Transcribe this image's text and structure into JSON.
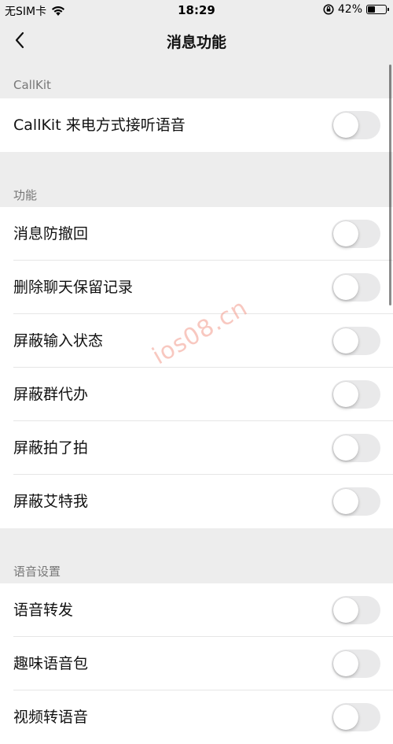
{
  "status_bar": {
    "carrier": "无SIM卡",
    "time": "18:29",
    "battery_percent": "42%",
    "battery_level": 0.42
  },
  "nav": {
    "title": "消息功能"
  },
  "sections": [
    {
      "header": "CallKit",
      "items": [
        {
          "label": "CallKit 来电方式接听语音",
          "enabled": false
        }
      ]
    },
    {
      "header": "功能",
      "items": [
        {
          "label": "消息防撤回",
          "enabled": false
        },
        {
          "label": "删除聊天保留记录",
          "enabled": false
        },
        {
          "label": "屏蔽输入状态",
          "enabled": false
        },
        {
          "label": "屏蔽群代办",
          "enabled": false
        },
        {
          "label": "屏蔽拍了拍",
          "enabled": false
        },
        {
          "label": "屏蔽艾特我",
          "enabled": false
        }
      ]
    },
    {
      "header": "语音设置",
      "items": [
        {
          "label": "语音转发",
          "enabled": false
        },
        {
          "label": "趣味语音包",
          "enabled": false
        },
        {
          "label": "视频转语音",
          "enabled": false
        }
      ]
    }
  ],
  "watermark": "ios08.cn",
  "colors": {
    "background": "#ededed",
    "toggle_off": "#e9e9ea",
    "section_header": "#777777"
  }
}
